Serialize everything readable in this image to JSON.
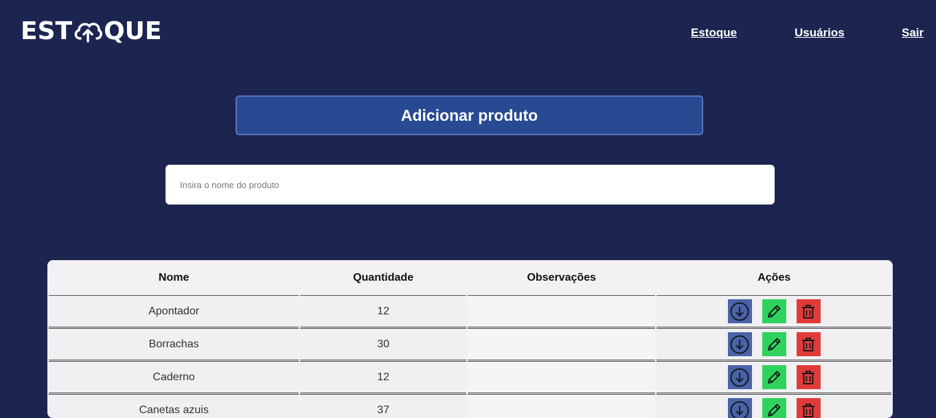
{
  "header": {
    "logo_left": "EST",
    "logo_right": "QUE",
    "nav": {
      "estoque": "Estoque",
      "usuarios": "Usuários",
      "sair": "Sair"
    }
  },
  "main": {
    "add_button": "Adicionar produto",
    "search_placeholder": "Insira o nome do produto"
  },
  "table": {
    "headers": {
      "nome": "Nome",
      "quantidade": "Quantidade",
      "observacoes": "Observações",
      "acoes": "Ações"
    },
    "rows": [
      {
        "nome": "Apontador",
        "quantidade": "12",
        "observacoes": ""
      },
      {
        "nome": "Borrachas",
        "quantidade": "30",
        "observacoes": ""
      },
      {
        "nome": "Caderno",
        "quantidade": "12",
        "observacoes": ""
      },
      {
        "nome": "Canetas azuis",
        "quantidade": "37",
        "observacoes": ""
      }
    ]
  },
  "colors": {
    "background": "#1b2550",
    "primary_button": "#274a93",
    "download_action": "#4a63a8",
    "edit_action": "#2fd25c",
    "delete_action": "#e03b3b"
  },
  "icons": [
    "cloud-upload-icon",
    "download-icon",
    "pencil-icon",
    "trash-icon"
  ]
}
